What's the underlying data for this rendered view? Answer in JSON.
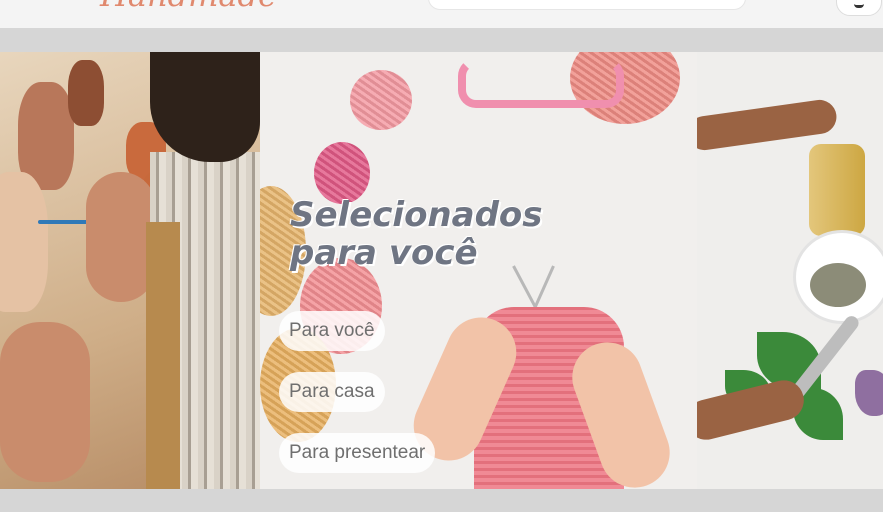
{
  "header": {
    "logo_text": "Handmade",
    "search_placeholder": "",
    "cart_icon": "cart-icon"
  },
  "hero": {
    "headline": "Selecionados para você",
    "buttons": [
      {
        "label": "Para você"
      },
      {
        "label": "Para casa"
      },
      {
        "label": "Para presentear"
      }
    ]
  },
  "colors": {
    "accent": "#e0896e",
    "headline": "#6f7583",
    "background": "#d6d6d6"
  }
}
